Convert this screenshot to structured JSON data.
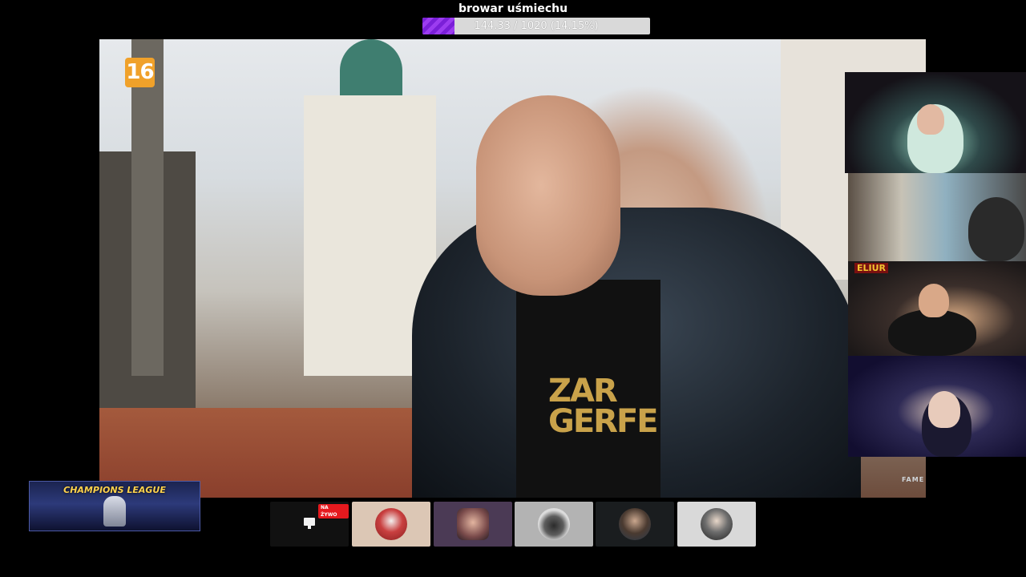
{
  "goal": {
    "title": "browar uśmiechu",
    "progress_text": "144.33 / 1020 (14.15%)",
    "current": 144.33,
    "target": 1020,
    "percent": 14.15,
    "fill_color": "#8b2be2"
  },
  "main_video": {
    "age_rating": "16",
    "watermark": "FAME",
    "shirt_print_line1": "ZAR",
    "shirt_print_line2": "GERFE"
  },
  "webcams": [
    {
      "name": "cam-1"
    },
    {
      "name": "cam-2"
    },
    {
      "name": "cam-3",
      "overlay_label": "ELIUR"
    },
    {
      "name": "cam-4"
    }
  ],
  "overlay": {
    "champions_league_text": "CHAMPIONS LEAGUE"
  },
  "thumbnails": [
    {
      "id": "screen-share",
      "live_label": "NA ŻYWO",
      "icon": "monitor-icon"
    },
    {
      "id": "participant-1"
    },
    {
      "id": "participant-2"
    },
    {
      "id": "participant-3"
    },
    {
      "id": "participant-4"
    },
    {
      "id": "participant-5"
    }
  ]
}
